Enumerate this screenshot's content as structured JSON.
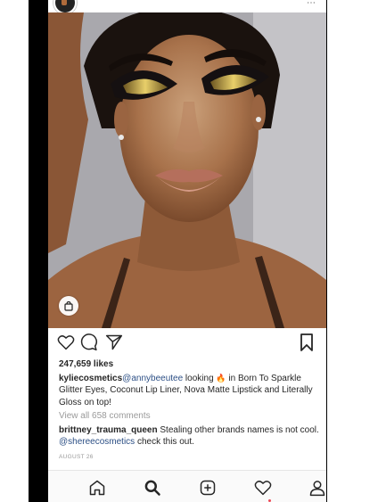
{
  "post": {
    "likes": "247,659 likes",
    "caption_user": "kyliecosmetics",
    "caption_mention": "@annybeeutee",
    "caption_text_1": " looking ",
    "caption_emoji": "🔥",
    "caption_text_2": " in Born To Sparkle Glitter Eyes, Coconut Lip Liner, Nova Matte Lipstick and Literally Gloss on top!",
    "view_comments": "View all 658 comments",
    "comment_user": "brittney_trauma_queen",
    "comment_text_1": " Stealing other brands names is not cool. ",
    "comment_mention": "@shereecosmetics",
    "comment_text_2": " check this out.",
    "date": "AUGUST 26"
  },
  "icons": {
    "like": "heart-icon",
    "comment": "comment-icon",
    "share": "send-icon",
    "save": "bookmark-icon",
    "shop": "shopping-bag-icon",
    "home": "home-icon",
    "search": "search-icon",
    "add": "add-post-icon",
    "activity": "activity-heart-icon",
    "profile": "profile-icon"
  },
  "colors": {
    "text": "#262626",
    "mention": "#2c4f85",
    "muted": "#9a9a9a",
    "notification": "#ed4956"
  }
}
